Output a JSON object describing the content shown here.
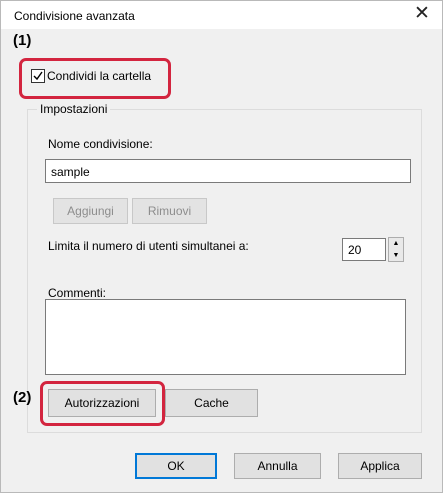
{
  "dialog": {
    "title": "Condivisione avanzata",
    "close_glyph": "✕"
  },
  "annotations": {
    "one": "(1)",
    "two": "(2)",
    "highlight_color": "#d3253f"
  },
  "share_checkbox": {
    "label": "Condividi la cartella",
    "checked": true
  },
  "settings": {
    "legend": "Impostazioni",
    "share_name_label": "Nome condivisione:",
    "share_name_value": "sample",
    "add_label": "Aggiungi",
    "remove_label": "Rimuovi",
    "limit_label": "Limita il numero di utenti simultanei a:",
    "limit_value": "20",
    "comments_label": "Commenti:",
    "comments_value": "",
    "permissions_label": "Autorizzazioni",
    "cache_label": "Cache"
  },
  "footer": {
    "ok_label": "OK",
    "cancel_label": "Annulla",
    "apply_label": "Applica"
  }
}
